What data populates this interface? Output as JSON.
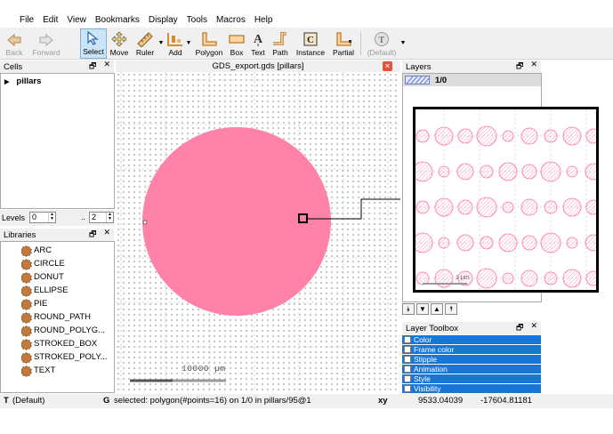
{
  "menu": [
    "File",
    "Edit",
    "View",
    "Bookmarks",
    "Display",
    "Tools",
    "Macros",
    "Help"
  ],
  "toolbar": {
    "back": "Back",
    "forward": "Forward",
    "select": "Select",
    "move": "Move",
    "ruler": "Ruler",
    "add": "Add",
    "polygon": "Polygon",
    "box": "Box",
    "text": "Text",
    "path": "Path",
    "instance": "Instance",
    "partial": "Partial",
    "default": "(Default)"
  },
  "cells": {
    "title": "Cells",
    "items": [
      "pillars"
    ],
    "levels_label": "Levels",
    "levels_from": "0",
    "levels_sep": "..",
    "levels_to": "2"
  },
  "libraries": {
    "title": "Libraries",
    "items": [
      "ARC",
      "CIRCLE",
      "DONUT",
      "ELLIPSE",
      "PIE",
      "ROUND_PATH",
      "ROUND_POLYG...",
      "STROKED_BOX",
      "STROKED_POLY...",
      "TEXT"
    ]
  },
  "canvas": {
    "title": "GDS_export.gds [pillars]",
    "scale_label": "10000  µm",
    "shape_color": "#ff82a8"
  },
  "layers": {
    "title": "Layers",
    "items": [
      "1/0"
    ],
    "inset_scale_label": "1 µm"
  },
  "layer_toolbox": {
    "title": "Layer Toolbox",
    "items": [
      "Color",
      "Frame color",
      "Stipple",
      "Animation",
      "Style",
      "Visibility"
    ]
  },
  "status": {
    "mode_key": "T",
    "mode_value": "(Default)",
    "grid_key": "G",
    "message": "selected: polygon(#points=16) on 1/0 in pillars/95@1",
    "coord_label": "xy",
    "x": "9533.04039",
    "y": "-17604.81181"
  },
  "colors": {
    "accent": "#1777d4",
    "shape": "#ff82a8",
    "close_button": "#e0533c"
  }
}
